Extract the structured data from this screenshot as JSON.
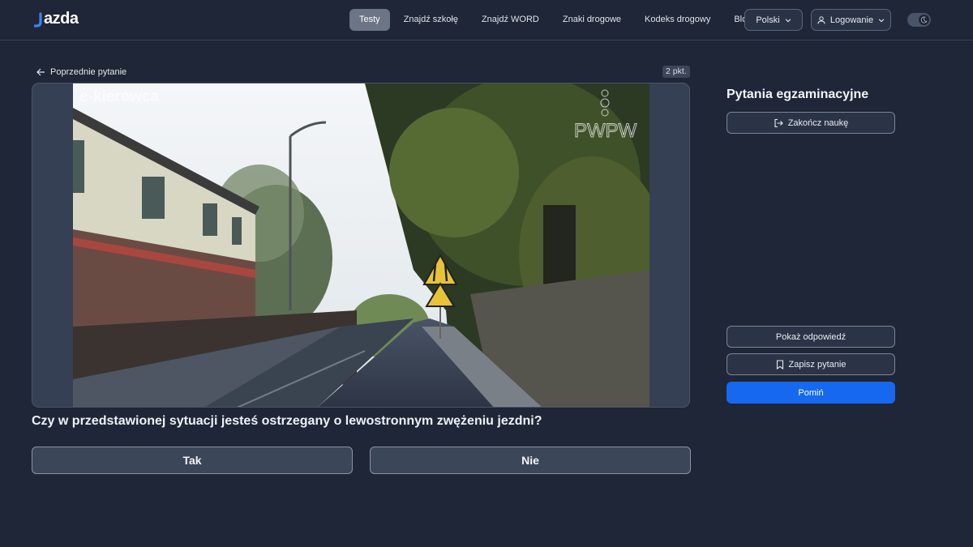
{
  "header": {
    "logo_text": "azda",
    "nav": [
      "Testy",
      "Znajdź szkołę",
      "Znajdź WORD",
      "Znaki drogowe",
      "Kodeks drogowy",
      "Blog"
    ],
    "active_nav": "Testy",
    "language_label": "Polski",
    "login_label": "Logowanie",
    "theme_toggle_icon": "moon-icon"
  },
  "question": {
    "prev_label": "Poprzednie pytanie",
    "points_label": "2 pkt.",
    "text": "Czy w przedstawionej sytuacji jesteś ostrzegany o lewostronnym zwężeniu jezdni?",
    "media": {
      "watermark_left": "e-kierowca",
      "watermark_right": "PWPW"
    },
    "answers": [
      "Tak",
      "Nie"
    ]
  },
  "sidebar": {
    "title": "Pytania egzaminacyjne",
    "end_label": "Zakończ naukę",
    "show_answer_label": "Pokaż odpowiedź",
    "save_label": "Zapisz pytanie",
    "skip_label": "Pomiń"
  },
  "colors": {
    "background": "#1e2637",
    "accent": "#1668f0",
    "logo_accent": "#3b82f6"
  }
}
